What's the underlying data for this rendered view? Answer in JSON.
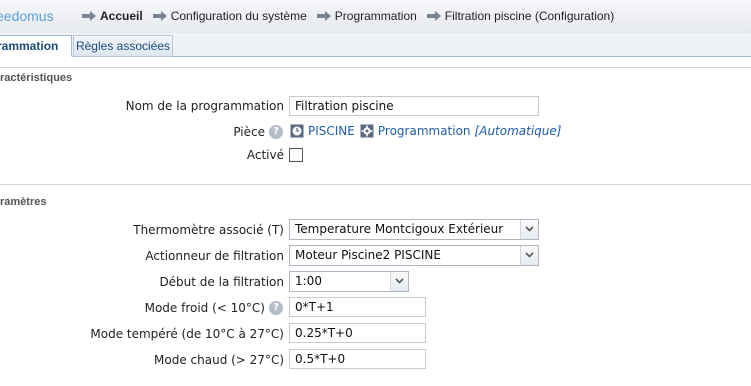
{
  "logo": {
    "text": "eedomus"
  },
  "breadcrumb": [
    "Accueil",
    "Configuration du système",
    "Programmation",
    "Filtration piscine (Configuration)"
  ],
  "tabs": {
    "active": "rammation",
    "second": "Règles associées"
  },
  "sections": {
    "characteristics": "ractéristiques",
    "parameters": "ramètres"
  },
  "form": {
    "name_label": "Nom de la programmation",
    "name_value": "Filtration piscine",
    "room_label": "Pièce",
    "room_name": "PISCINE",
    "room_prog": "Programmation",
    "room_mode": "[Automatique]",
    "active_label": "Activé",
    "thermo_label": "Thermomètre associé (T)",
    "thermo_value": "Temperature Montcigoux Extérieur",
    "actuator_label": "Actionneur de filtration",
    "actuator_value": "Moteur Piscine2 PISCINE",
    "start_label": "Début de la filtration",
    "start_value": "1:00",
    "cold_label": "Mode froid (< 10°C)",
    "cold_value": "0*T+1",
    "temperate_label": "Mode tempéré (de 10°C à 27°C)",
    "temperate_value": "0.25*T+0",
    "hot_label": "Mode chaud (> 27°C)",
    "hot_value": "0.5*T+0"
  },
  "colors": {
    "link": "#1f5fa8",
    "tab_text": "#1b4b7c",
    "logo": "#5ba3d6"
  },
  "icons": [
    "arrow-right-icon",
    "help-icon",
    "clock-icon",
    "gear-icon",
    "chevron-down-icon"
  ]
}
